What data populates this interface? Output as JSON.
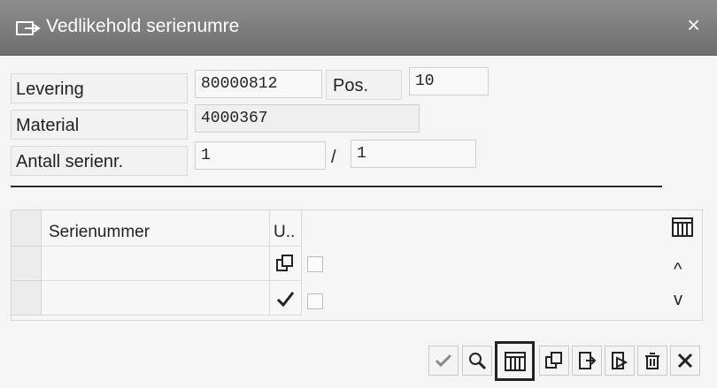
{
  "dialog": {
    "title": "Vedlikehold serienumre"
  },
  "form": {
    "levering_label": "Levering",
    "levering_value": "80000812",
    "pos_label": "Pos.",
    "pos_value": "10",
    "material_label": "Material",
    "material_value": "4000367",
    "antall_label": "Antall serienr.",
    "antall_value": "1",
    "antall_sep": "/",
    "antall_total": "1"
  },
  "table": {
    "headers": [
      "Serienummer",
      "U.."
    ],
    "rows": [
      {
        "serial": "",
        "u_icon": "copy-icon"
      },
      {
        "serial": "",
        "u_icon": "checkmark-icon"
      }
    ]
  },
  "toolbar": {
    "buttons": [
      "confirm-check-icon",
      "find-icon",
      "columns-icon",
      "copy-icon",
      "import-icon",
      "export-icon",
      "delete-icon",
      "cancel-icon"
    ],
    "active_button": "columns-icon"
  }
}
